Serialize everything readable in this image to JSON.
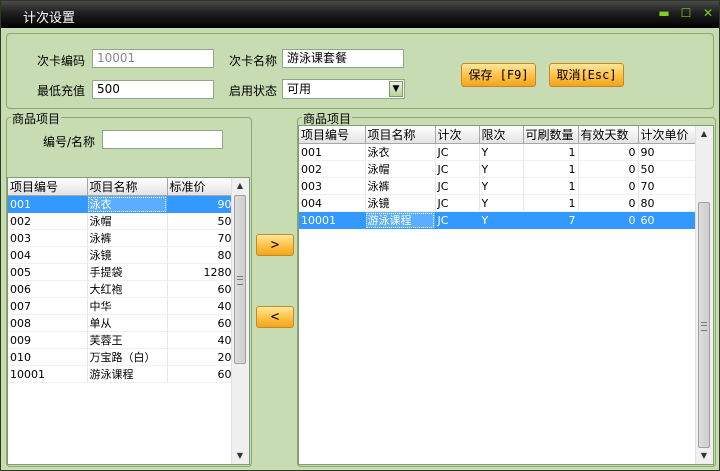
{
  "window": {
    "title": "计次设置",
    "minimize_glyph": "▬",
    "maximize_glyph": "☐",
    "close_glyph": "✕"
  },
  "form": {
    "card_code_label": "次卡编码",
    "card_code_value": "10001",
    "card_name_label": "次卡名称",
    "card_name_value": "游泳课套餐",
    "min_recharge_label": "最低充值",
    "min_recharge_value": "500",
    "status_label": "启用状态",
    "status_value": "可用"
  },
  "buttons": {
    "save": "保存 [F9]",
    "cancel": "取消[Esc]",
    "add": ">",
    "remove": "<"
  },
  "left_group": {
    "title": "商品项目",
    "search_label": "编号/名称",
    "search_value": "",
    "columns": [
      "项目编号",
      "项目名称",
      "标准价"
    ],
    "rows": [
      [
        "001",
        "泳衣",
        "90"
      ],
      [
        "002",
        "泳帽",
        "50"
      ],
      [
        "003",
        "泳裤",
        "70"
      ],
      [
        "004",
        "泳镜",
        "80"
      ],
      [
        "005",
        "手提袋",
        "1280"
      ],
      [
        "006",
        "大红袍",
        "60"
      ],
      [
        "007",
        "中华",
        "40"
      ],
      [
        "008",
        "单从",
        "60"
      ],
      [
        "009",
        "芙蓉王",
        "40"
      ],
      [
        "010",
        "万宝路（白）",
        "20"
      ],
      [
        "10001",
        "游泳课程",
        "60"
      ]
    ],
    "selected_row": 0
  },
  "right_group": {
    "title": "商品项目",
    "columns": [
      "项目编号",
      "项目名称",
      "计次",
      "限次",
      "可刷数量",
      "有效天数",
      "计次单价"
    ],
    "rows": [
      [
        "001",
        "泳衣",
        "JC",
        "Y",
        "1",
        "0",
        "90"
      ],
      [
        "002",
        "泳帽",
        "JC",
        "Y",
        "1",
        "0",
        "50"
      ],
      [
        "003",
        "泳裤",
        "JC",
        "Y",
        "1",
        "0",
        "70"
      ],
      [
        "004",
        "泳镜",
        "JC",
        "Y",
        "1",
        "0",
        "80"
      ],
      [
        "10001",
        "游泳课程",
        "JC",
        "Y",
        "7",
        "0",
        "60"
      ]
    ],
    "selected_row": 4
  },
  "scroll_glyphs": {
    "up": "▲",
    "down": "▼"
  }
}
